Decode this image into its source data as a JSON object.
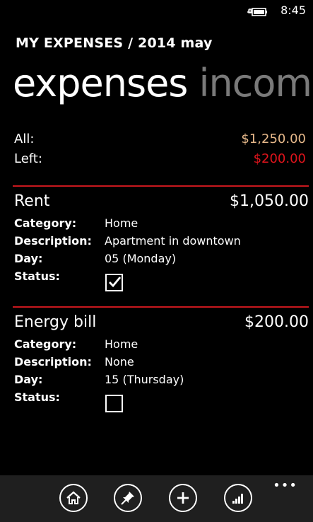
{
  "status_bar": {
    "time": "8:45",
    "icons": [
      "battery-charging-icon"
    ]
  },
  "app_title": "MY EXPENSES / 2014 may",
  "pivot": {
    "active": "expenses",
    "inactive": "income"
  },
  "summary": {
    "all_label": "All:",
    "all_value": "$1,250.00",
    "left_label": "Left:",
    "left_value": "$200.00",
    "all_color": "#e6b88a",
    "left_color": "#e0141c"
  },
  "field_labels": {
    "category": "Category:",
    "description": "Description:",
    "day": "Day:",
    "status": "Status:"
  },
  "expenses": [
    {
      "name": "Rent",
      "amount": "$1,050.00",
      "category": "Home",
      "description": "Apartment in downtown",
      "day": "05 (Monday)",
      "status_checked": true
    },
    {
      "name": "Energy bill",
      "amount": "$200.00",
      "category": "Home",
      "description": "None",
      "day": "15 (Thursday)",
      "status_checked": false
    }
  ],
  "app_bar": {
    "buttons": [
      "home-icon",
      "pin-icon",
      "add-icon",
      "chart-icon"
    ],
    "more": "•••"
  }
}
